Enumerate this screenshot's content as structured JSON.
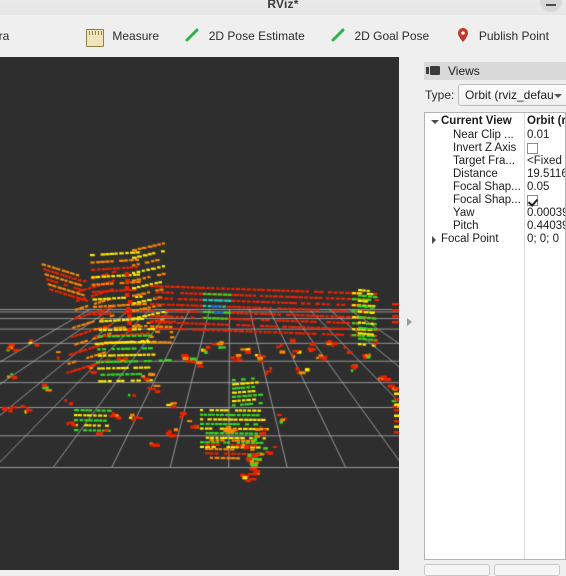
{
  "window": {
    "title": "RViz*",
    "minimize_icon": "minimize-icon"
  },
  "toolbar": {
    "clipped_left_label": "era",
    "overflow_icon": "toolbar-overflow-chevron-icon",
    "buttons": [
      {
        "label": "Measure",
        "icon": "measure-ruler-icon"
      },
      {
        "label": "2D Pose Estimate",
        "icon": "pose-arrow-icon"
      },
      {
        "label": "2D Goal Pose",
        "icon": "goal-arrow-icon"
      },
      {
        "label": "Publish Point",
        "icon": "map-pin-icon"
      },
      {
        "label": "",
        "icon": "plus-icon"
      },
      {
        "label": "",
        "icon": "minus-icon"
      }
    ]
  },
  "views_panel": {
    "title": "Views",
    "title_icon": "camera-icon",
    "type_label": "Type:",
    "type_value": "Orbit (rviz_defau",
    "tree": {
      "columns": [
        "Current View",
        "Orbit (r"
      ],
      "rows": [
        {
          "name": "Near Clip ...",
          "value": "0.01",
          "kind": "text",
          "indent": 1
        },
        {
          "name": "Invert Z Axis",
          "value": "",
          "kind": "checkbox",
          "checked": false,
          "indent": 1
        },
        {
          "name": "Target Fra...",
          "value": "<Fixed ",
          "kind": "text",
          "indent": 1
        },
        {
          "name": "Distance",
          "value": "19.5116",
          "kind": "text",
          "indent": 1
        },
        {
          "name": "Focal Shap...",
          "value": "0.05",
          "kind": "text",
          "indent": 1
        },
        {
          "name": "Focal Shap...",
          "value": "",
          "kind": "checkbox",
          "checked": true,
          "indent": 1
        },
        {
          "name": "Yaw",
          "value": "0.00039",
          "kind": "text",
          "indent": 1
        },
        {
          "name": "Pitch",
          "value": "0.44039",
          "kind": "text",
          "indent": 1
        },
        {
          "name": "Focal Point",
          "value": "0; 0; 0",
          "kind": "text",
          "indent": 1,
          "expandable": true
        }
      ]
    }
  },
  "viewport": {
    "background_color": "#2e2e2e",
    "grid_color": "#b4b4b4",
    "content": "3d-point-cloud-laser-scan",
    "colors": {
      "red": "#ee2200",
      "orange": "#ff8800",
      "yellow": "#ffee00",
      "green": "#33dd22",
      "cyan": "#00ddcc",
      "blue": "#1166ee"
    }
  },
  "splitter": {
    "handle_icon": "splitter-expand-arrow-icon"
  },
  "bottom_buttons": [
    {
      "label": ""
    },
    {
      "label": ""
    }
  ]
}
